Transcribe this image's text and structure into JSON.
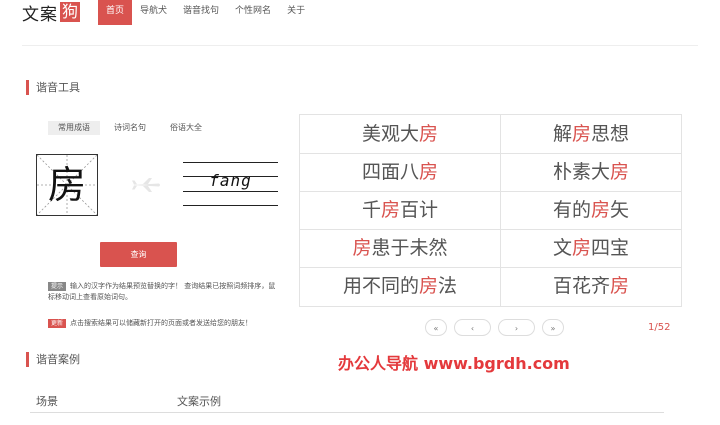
{
  "header": {
    "logo_text": "文案",
    "logo_box": "狗",
    "nav": [
      "首页",
      "导航犬",
      "谐音找句",
      "个性网名",
      "关于"
    ]
  },
  "tool_section": {
    "title": "谐音工具",
    "tabs": [
      "常用成语",
      "诗词名句",
      "俗语大全"
    ],
    "input_char": "房",
    "pinyin": "fang",
    "query_label": "查询",
    "tip_tag": "提示",
    "tip_text_1": "输入的汉字作为结果预览替换的字！  查询结果已按照词频排序，鼠",
    "tip_text_2": "标移动词上查看原始词句。",
    "update_tag": "更新",
    "update_text": "点击搜索结果可以储藏新打开的页面或者发送给您的朋友！"
  },
  "results": {
    "rows": [
      [
        {
          "pre": "美观大",
          "hl": "房",
          "post": ""
        },
        {
          "pre": "解",
          "hl": "房",
          "post": "思想"
        }
      ],
      [
        {
          "pre": "四面八",
          "hl": "房",
          "post": ""
        },
        {
          "pre": "朴素大",
          "hl": "房",
          "post": ""
        }
      ],
      [
        {
          "pre": "千",
          "hl": "房",
          "post": "百计"
        },
        {
          "pre": "有的",
          "hl": "房",
          "post": "矢"
        }
      ],
      [
        {
          "pre": "",
          "hl": "房",
          "post": "患于未然"
        },
        {
          "pre": "文",
          "hl": "房",
          "post": "四宝"
        }
      ],
      [
        {
          "pre": "用不同的",
          "hl": "房",
          "post": "法"
        },
        {
          "pre": "百花齐",
          "hl": "房",
          "post": ""
        }
      ]
    ],
    "pager": [
      "«",
      "‹",
      "›",
      "»"
    ],
    "page_count": "1/52"
  },
  "watermark": "办公人导航 www.bgrdh.com",
  "case_section": {
    "title": "谐音案例",
    "columns": [
      "场景",
      "文案示例"
    ]
  },
  "colors": {
    "accent": "#d9534f"
  }
}
